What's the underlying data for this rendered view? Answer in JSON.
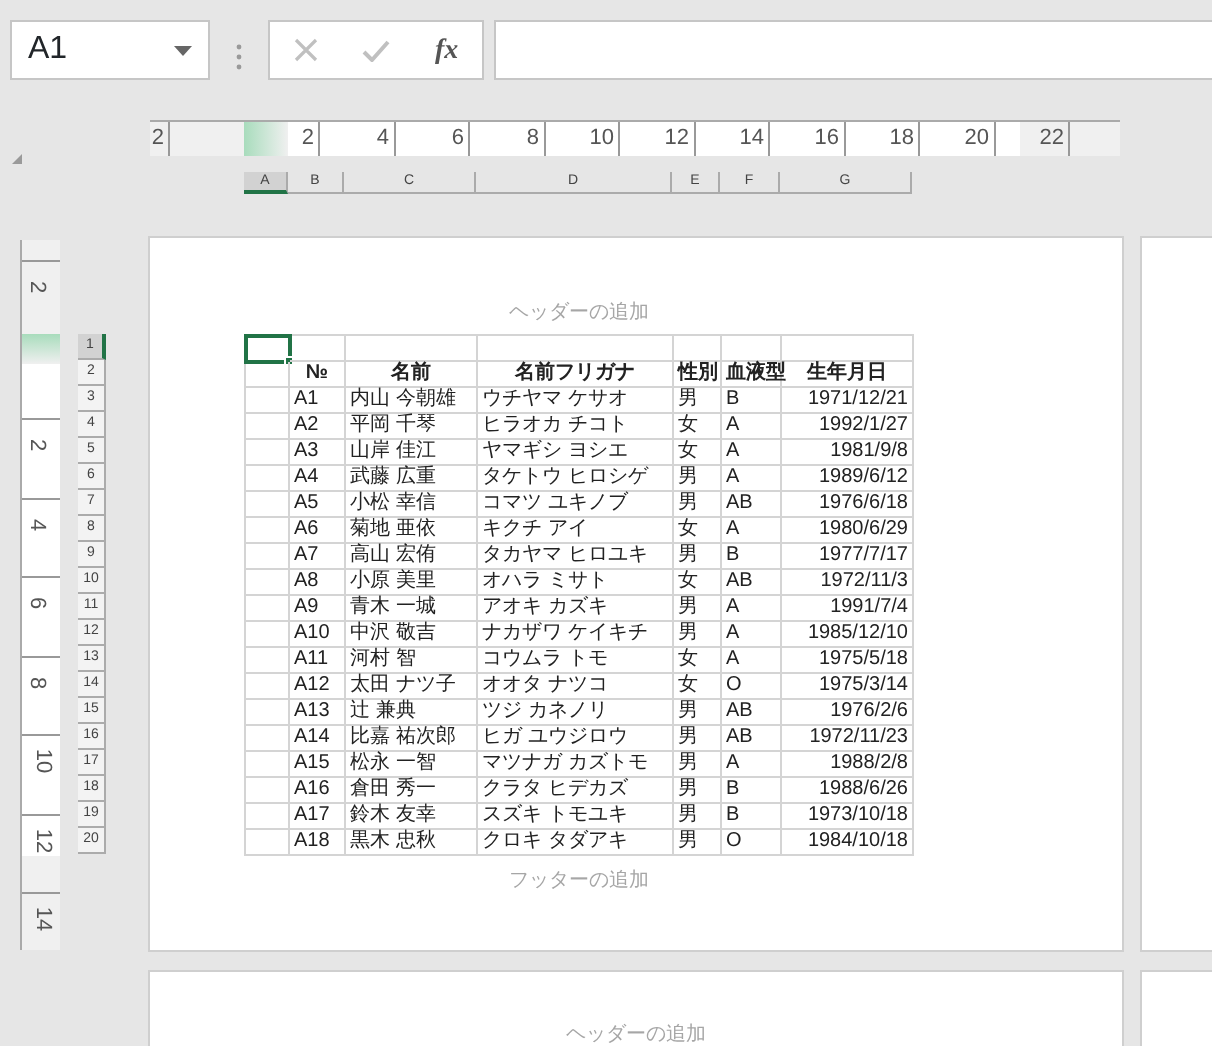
{
  "formula_bar": {
    "name_box": "A1",
    "function_button": "fx",
    "cancel_disabled": true,
    "enter_disabled": true
  },
  "rulers": {
    "horizontal": [
      "2",
      "2",
      "4",
      "6",
      "8",
      "10",
      "12",
      "14",
      "16",
      "18",
      "20",
      "22"
    ],
    "vertical": [
      "2",
      "2",
      "4",
      "6",
      "8",
      "10",
      "12",
      "14"
    ]
  },
  "column_headers": [
    {
      "label": "A",
      "selected": true
    },
    {
      "label": "B",
      "selected": false
    },
    {
      "label": "C",
      "selected": false
    },
    {
      "label": "D",
      "selected": false
    },
    {
      "label": "E",
      "selected": false
    },
    {
      "label": "F",
      "selected": false
    },
    {
      "label": "G",
      "selected": false
    }
  ],
  "row_headers": [
    {
      "label": "1",
      "selected": true
    },
    {
      "label": "2",
      "selected": false
    },
    {
      "label": "3",
      "selected": false
    },
    {
      "label": "4",
      "selected": false
    },
    {
      "label": "5",
      "selected": false
    },
    {
      "label": "6",
      "selected": false
    },
    {
      "label": "7",
      "selected": false
    },
    {
      "label": "8",
      "selected": false
    },
    {
      "label": "9",
      "selected": false
    },
    {
      "label": "10",
      "selected": false
    },
    {
      "label": "11",
      "selected": false
    },
    {
      "label": "12",
      "selected": false
    },
    {
      "label": "13",
      "selected": false
    },
    {
      "label": "14",
      "selected": false
    },
    {
      "label": "15",
      "selected": false
    },
    {
      "label": "16",
      "selected": false
    },
    {
      "label": "17",
      "selected": false
    },
    {
      "label": "18",
      "selected": false
    },
    {
      "label": "19",
      "selected": false
    },
    {
      "label": "20",
      "selected": false
    }
  ],
  "page": {
    "header_placeholder": "ヘッダーの追加",
    "footer_placeholder": "フッターの追加",
    "table_header": [
      "№",
      "名前",
      "名前フリガナ",
      "性別",
      "血液型",
      "生年月日"
    ],
    "rows": [
      [
        "A1",
        "内山 今朝雄",
        "ウチヤマ ケサオ",
        "男",
        "B",
        "1971/12/21"
      ],
      [
        "A2",
        "平岡 千琴",
        "ヒラオカ チコト",
        "女",
        "A",
        "1992/1/27"
      ],
      [
        "A3",
        "山岸 佳江",
        "ヤマギシ ヨシエ",
        "女",
        "A",
        "1981/9/8"
      ],
      [
        "A4",
        "武藤 広重",
        "タケトウ ヒロシゲ",
        "男",
        "A",
        "1989/6/12"
      ],
      [
        "A5",
        "小松 幸信",
        "コマツ ユキノブ",
        "男",
        "AB",
        "1976/6/18"
      ],
      [
        "A6",
        "菊地 亜依",
        "キクチ アイ",
        "女",
        "A",
        "1980/6/29"
      ],
      [
        "A7",
        "高山 宏侑",
        "タカヤマ ヒロユキ",
        "男",
        "B",
        "1977/7/17"
      ],
      [
        "A8",
        "小原 美里",
        "オハラ ミサト",
        "女",
        "AB",
        "1972/11/3"
      ],
      [
        "A9",
        "青木 一城",
        "アオキ カズキ",
        "男",
        "A",
        "1991/7/4"
      ],
      [
        "A10",
        "中沢 敬吉",
        "ナカザワ ケイキチ",
        "男",
        "A",
        "1985/12/10"
      ],
      [
        "A11",
        "河村 智",
        "コウムラ トモ",
        "女",
        "A",
        "1975/5/18"
      ],
      [
        "A12",
        "太田 ナツ子",
        "オオタ ナツコ",
        "女",
        "O",
        "1975/3/14"
      ],
      [
        "A13",
        "辻 兼典",
        "ツジ カネノリ",
        "男",
        "AB",
        "1976/2/6"
      ],
      [
        "A14",
        "比嘉 祐次郎",
        "ヒガ ユウジロウ",
        "男",
        "AB",
        "1972/11/23"
      ],
      [
        "A15",
        "松永 一智",
        "マツナガ カズトモ",
        "男",
        "A",
        "1988/2/8"
      ],
      [
        "A16",
        "倉田 秀一",
        "クラタ ヒデカズ",
        "男",
        "B",
        "1988/6/26"
      ],
      [
        "A17",
        "鈴木 友幸",
        "スズキ トモユキ",
        "男",
        "B",
        "1973/10/18"
      ],
      [
        "A18",
        "黒木 忠秋",
        "クロキ タダアキ",
        "男",
        "O",
        "1984/10/18"
      ]
    ]
  },
  "next_page": {
    "header_placeholder": "ヘッダーの追加"
  }
}
